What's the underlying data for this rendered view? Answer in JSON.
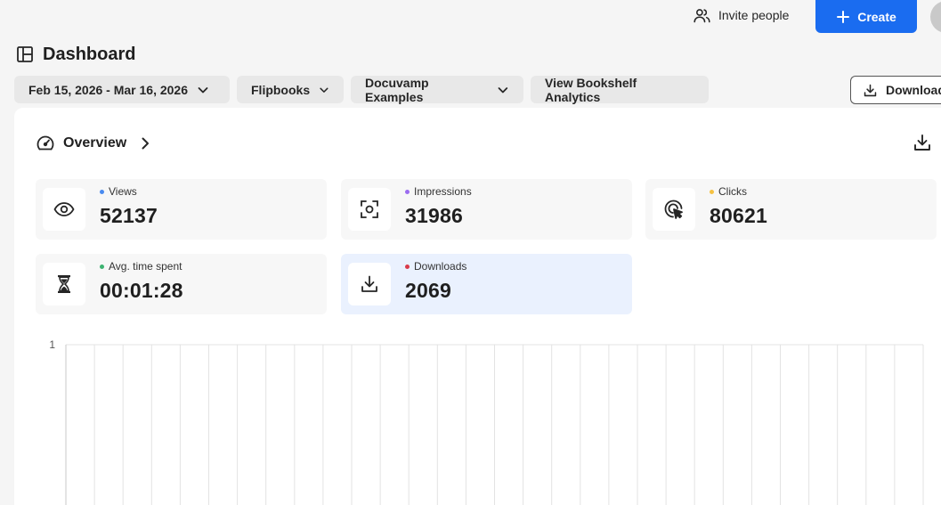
{
  "header": {
    "invite_label": "Invite people",
    "create_label": "Create"
  },
  "page": {
    "title": "Dashboard"
  },
  "filters": {
    "date_range": "Feb 15, 2026 - Mar 16, 2026",
    "type": "Flipbooks",
    "bookshelf": "Docuvamp Examples",
    "analytics_link": "View Bookshelf Analytics",
    "download_label": "Download"
  },
  "overview": {
    "title": "Overview",
    "cards": [
      {
        "label": "Views",
        "value": "52137",
        "dot_color": "#4a8bf0",
        "icon": "eye-icon"
      },
      {
        "label": "Impressions",
        "value": "31986",
        "dot_color": "#9b6cf0",
        "icon": "scan-icon"
      },
      {
        "label": "Clicks",
        "value": "80621",
        "dot_color": "#f5c242",
        "icon": "cursor-click-icon"
      },
      {
        "label": "Avg. time spent",
        "value": "00:01:28",
        "dot_color": "#3cb371",
        "icon": "hourglass-icon"
      },
      {
        "label": "Downloads",
        "value": "2069",
        "dot_color": "#d93a4a",
        "icon": "download-icon"
      }
    ]
  },
  "chart_data": {
    "type": "line",
    "y_tick_labels": [
      "1"
    ],
    "ylim": [
      0,
      1
    ],
    "vertical_gridlines": 30,
    "grid": true,
    "series": []
  },
  "colors": {
    "accent": "#1a6cf0",
    "highlight_card": "#eaf1fe"
  }
}
